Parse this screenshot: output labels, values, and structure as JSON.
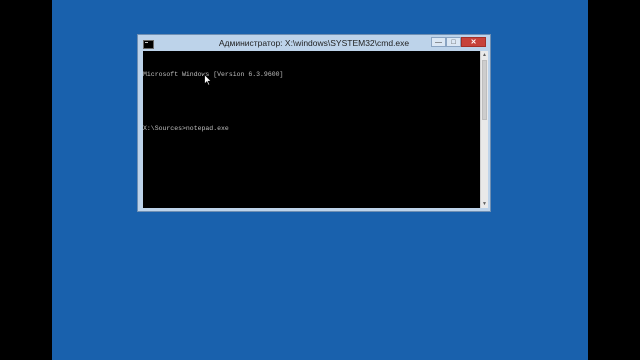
{
  "window": {
    "title": "Администратор: X:\\windows\\SYSTEM32\\cmd.exe",
    "controls": {
      "minimize": "—",
      "maximize": "□",
      "close": "✕"
    }
  },
  "console": {
    "lines": [
      "Microsoft Windows [Version 6.3.9600]",
      "",
      "X:\\Sources>notepad.exe"
    ]
  },
  "icons": {
    "title_icon": "cmd-icon",
    "cursor": "mouse-pointer-icon"
  },
  "colors": {
    "desktop": "#1961ad",
    "console_bg": "#000000",
    "console_text": "#c0c0c0",
    "close_button": "#c7423a"
  }
}
